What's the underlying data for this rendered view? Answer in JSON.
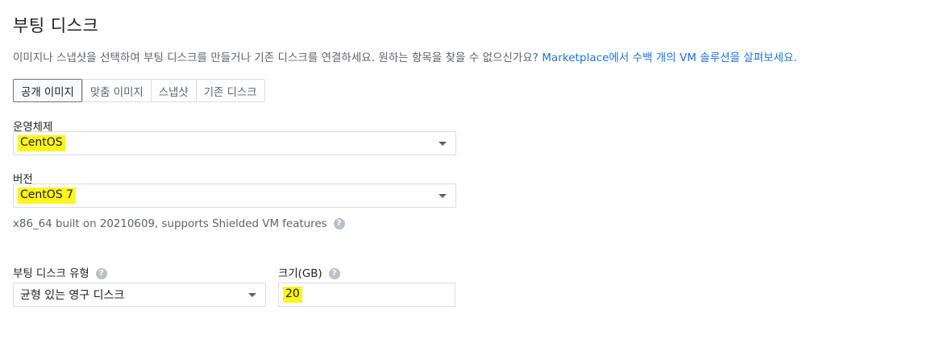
{
  "title": "부팅 디스크",
  "description": {
    "text": "이미지나 스냅샷을 선택하여 부팅 디스크를 만들거나 기존 디스크를 연결하세요. 원하는 항목을 찾을 수 없으신가요? ",
    "link": "Marketplace에서 수백 개의 VM 솔루션을 살펴보세요."
  },
  "tabs": [
    {
      "label": "공개 이미지",
      "active": true
    },
    {
      "label": "맞춤 이미지",
      "active": false
    },
    {
      "label": "스냅샷",
      "active": false
    },
    {
      "label": "기존 디스크",
      "active": false
    }
  ],
  "os": {
    "label": "운영체제",
    "value": "CentOS"
  },
  "version": {
    "label": "버전",
    "value": "CentOS 7"
  },
  "image_info": "x86_64 built on 20210609, supports Shielded VM features",
  "disk_type": {
    "label": "부팅 디스크 유형",
    "value": "균형 있는 영구 디스크"
  },
  "size": {
    "label": "크기(GB)",
    "value": "20"
  },
  "colors": {
    "highlight": "#fdf51b",
    "link": "#1a73e8"
  }
}
